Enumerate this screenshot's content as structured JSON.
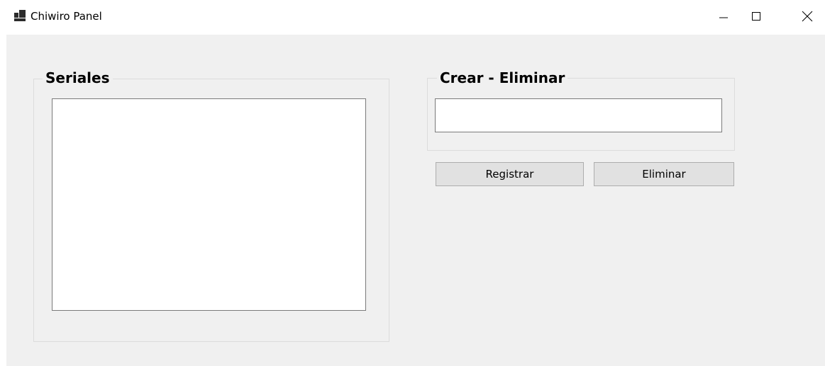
{
  "window": {
    "title": "Chiwiro Panel",
    "icon": "app-window-icon",
    "controls": {
      "minimize_icon": "minimize-icon",
      "maximize_icon": "maximize-icon",
      "close_icon": "close-icon"
    }
  },
  "seriales_group": {
    "title": "Seriales",
    "items": []
  },
  "crear_group": {
    "title": "Crear - Eliminar",
    "input_value": ""
  },
  "buttons": {
    "registrar": "Registrar",
    "eliminar": "Eliminar"
  },
  "colors": {
    "client_background": "#f0f0f0",
    "button_background": "#e1e1e1",
    "button_border": "#adadad",
    "input_border": "#7a7a7a"
  }
}
